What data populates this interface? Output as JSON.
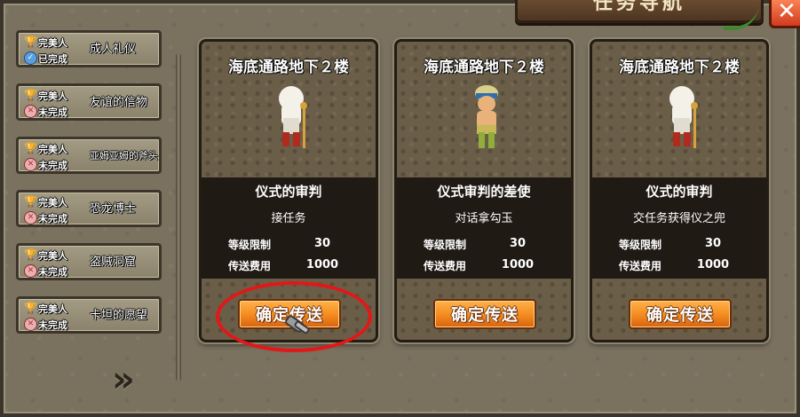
{
  "window": {
    "title": "任务导航",
    "close_label": "✕"
  },
  "sidebar": {
    "items": [
      {
        "kind": "完美人",
        "status": "已完成",
        "state": "done",
        "name": "成人礼仪"
      },
      {
        "kind": "完美人",
        "status": "未完成",
        "state": "todo",
        "name": "友谊的信物"
      },
      {
        "kind": "完美人",
        "status": "未完成",
        "state": "todo",
        "name": "亚姆亚姆的斧头"
      },
      {
        "kind": "完美人",
        "status": "未完成",
        "state": "todo",
        "name": "恐龙博士"
      },
      {
        "kind": "完美人",
        "status": "未完成",
        "state": "todo",
        "name": "盗贼洞窟"
      },
      {
        "kind": "完美人",
        "status": "未完成",
        "state": "todo",
        "name": "卡坦的愿望"
      }
    ],
    "next_label": "»"
  },
  "cards": [
    {
      "location": "海底通路地下２楼",
      "npc": "white-haired-elder",
      "quest": "仪式的审判",
      "action": "接任务",
      "level_label": "等级限制",
      "level": "30",
      "fee_label": "传送费用",
      "fee": "1000",
      "button": "确定传送"
    },
    {
      "location": "海底通路地下２楼",
      "npc": "turbaned-villager",
      "quest": "仪式审判的差使",
      "action": "对话拿勾玉",
      "level_label": "等级限制",
      "level": "30",
      "fee_label": "传送费用",
      "fee": "1000",
      "button": "确定传送"
    },
    {
      "location": "海底通路地下２楼",
      "npc": "white-haired-elder",
      "quest": "仪式的审判",
      "action": "交任务获得仪之兜",
      "level_label": "等级限制",
      "level": "30",
      "fee_label": "传送费用",
      "fee": "1000",
      "button": "确定传送"
    }
  ],
  "colors": {
    "accent_button": "#f38a1e",
    "highlight_ring": "#e21818",
    "done_icon": "#5aa0e0",
    "todo_icon": "#e8b0b0"
  }
}
